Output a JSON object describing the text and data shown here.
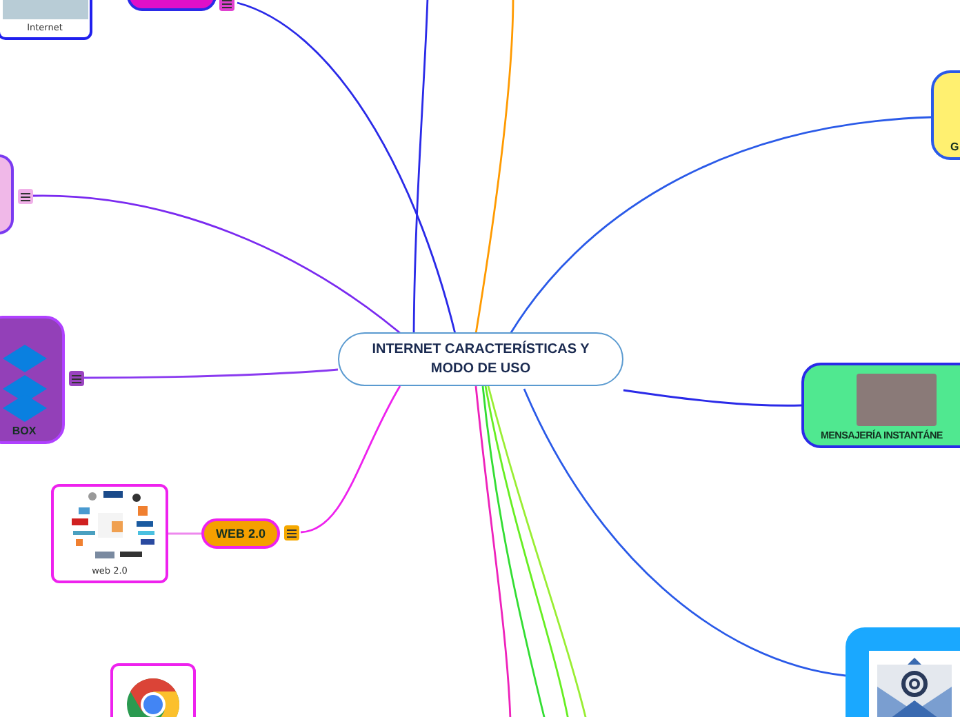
{
  "central": {
    "title": "INTERNET CARACTERÍSTICAS Y MODO DE USO"
  },
  "nodes": [
    {
      "kind": "network",
      "caption": "Internet",
      "note": false
    },
    {
      "kind": "pill",
      "note": true
    },
    {
      "kind": "blank",
      "note": true
    },
    {
      "kind": "dropbox",
      "label": "BOX",
      "note": true
    },
    {
      "kind": "logos",
      "caption": "web 2.0",
      "note": false
    },
    {
      "kind": "pill",
      "label": "WEB 2.0",
      "note": true
    },
    {
      "kind": "chrome",
      "note": false
    },
    {
      "kind": "plain",
      "label": "G",
      "note": false
    },
    {
      "kind": "phone",
      "label": "MENSAJERÍA INSTANTÁNE",
      "note": false
    },
    {
      "kind": "email",
      "note": false
    }
  ]
}
